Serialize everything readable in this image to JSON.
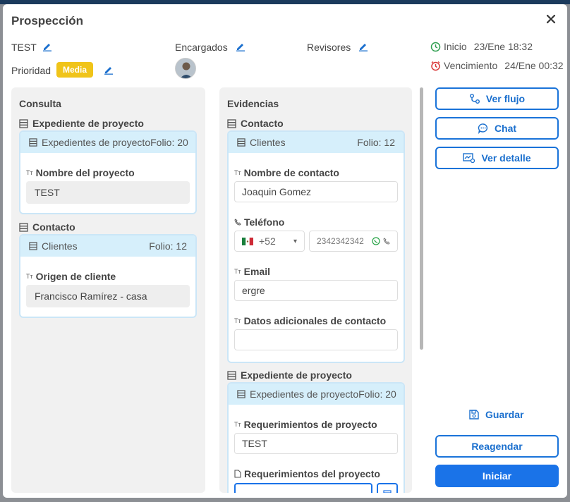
{
  "modal": {
    "title": "Prospección",
    "name": "TEST",
    "encargados_label": "Encargados",
    "revisores_label": "Revisores",
    "prioridad_label": "Prioridad",
    "prioridad_value": "Media",
    "inicio_label": "Inicio",
    "inicio_value": "23/Ene 18:32",
    "vencimiento_label": "Vencimiento",
    "vencimiento_value": "24/Ene 00:32"
  },
  "consulta": {
    "title": "Consulta",
    "sections": [
      {
        "title": "Expediente de proyecto",
        "card_label": "Expedientes de proyecto",
        "folio": "Folio: 20",
        "field_label": "Nombre del proyecto",
        "field_value": "TEST"
      },
      {
        "title": "Contacto",
        "card_label": "Clientes",
        "folio": "Folio: 12",
        "field_label": "Origen de cliente",
        "field_value": "Francisco Ramírez - casa"
      }
    ]
  },
  "evidencias": {
    "title": "Evidencias",
    "contacto": {
      "title": "Contacto",
      "card_label": "Clientes",
      "folio": "Folio: 12",
      "nombre_label": "Nombre de contacto",
      "nombre_value": "Joaquin Gomez",
      "telefono_label": "Teléfono",
      "country_code": "+52",
      "phone_value": "2342342342",
      "email_label": "Email",
      "email_value": "ergre",
      "datos_label": "Datos adicionales de contacto",
      "datos_value": ""
    },
    "expediente": {
      "title": "Expediente de proyecto",
      "card_label": "Expedientes de proyecto",
      "folio": "Folio: 20",
      "req1_label": "Requerimientos de proyecto",
      "req1_value": "TEST",
      "req2_label": "Requerimientos del proyecto"
    }
  },
  "actions": {
    "ver_flujo": "Ver flujo",
    "chat": "Chat",
    "ver_detalle": "Ver detalle",
    "guardar": "Guardar",
    "reagendar": "Reagendar",
    "iniciar": "Iniciar"
  },
  "colors": {
    "primary": "#1a73e8",
    "badge": "#f0c419",
    "card_header": "#d6effb",
    "inicio_icon": "#2e9e4f",
    "vencimiento_icon": "#d93636"
  }
}
